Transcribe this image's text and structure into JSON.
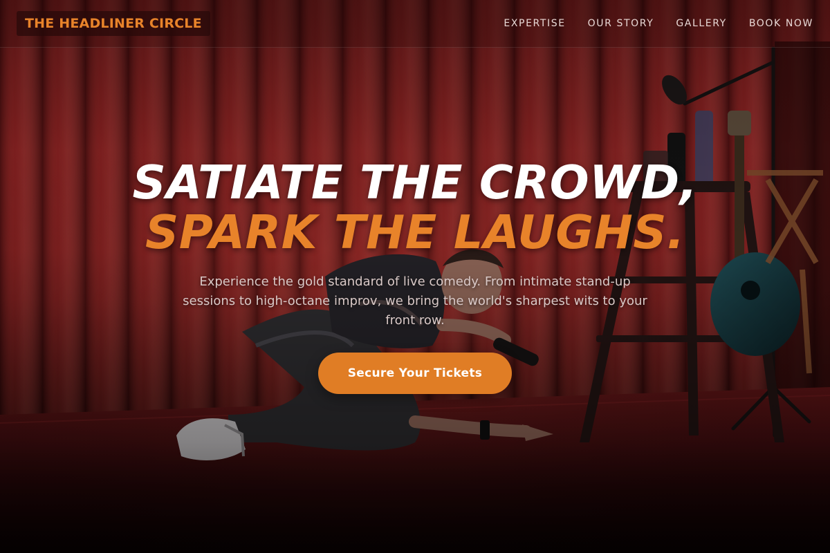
{
  "header": {
    "logo_text": "THE HEADLINER CIRCLE",
    "nav": [
      {
        "label": "EXPERTISE"
      },
      {
        "label": "OUR STORY"
      },
      {
        "label": "GALLERY"
      },
      {
        "label": "BOOK NOW"
      }
    ]
  },
  "hero": {
    "headline_line1": "SATIATE THE CROWD,",
    "headline_line2": "SPARK THE LAUGHS.",
    "subtitle": "Experience the gold standard of live comedy. From intimate stand-up sessions to high-octane improv, we bring the world's sharpest wits to your front row.",
    "cta_label": "Secure Your Tickets"
  },
  "colors": {
    "accent": "#e8832a",
    "button": "#e07d25",
    "curtain": "#8f1c1f",
    "text_light": "#ffffff"
  },
  "background_image": "comedian on stage lying on floor with microphone, red curtain, stool, guitar, mic stand"
}
